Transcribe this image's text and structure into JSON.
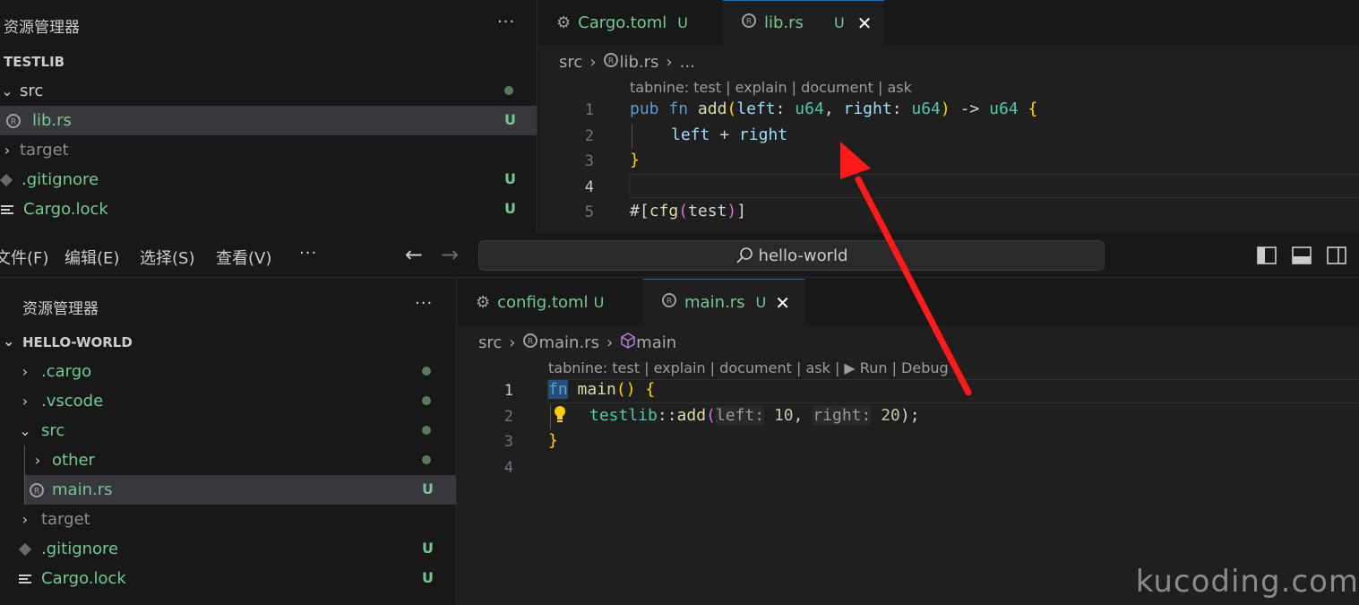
{
  "top_window": {
    "sidebar": {
      "title": "资源管理器",
      "more": "···",
      "project": "TESTLIB",
      "items": [
        {
          "label": "src",
          "badge": ""
        },
        {
          "label": "lib.rs",
          "badge": "U"
        },
        {
          "label": "target",
          "badge": ""
        },
        {
          "label": ".gitignore",
          "badge": "U"
        },
        {
          "label": "Cargo.lock",
          "badge": "U"
        }
      ]
    },
    "tabs": [
      {
        "label": "Cargo.toml",
        "badge": "U"
      },
      {
        "label": "lib.rs",
        "badge": "U",
        "close": "✕"
      }
    ],
    "breadcrumb": {
      "folder": "src",
      "file": "lib.rs",
      "tail": "..."
    },
    "codelens": "tabnine: test | explain | document | ask",
    "line_numbers": [
      "1",
      "2",
      "3",
      "4",
      "5"
    ],
    "code": {
      "l1": {
        "pub": "pub",
        "fn": "fn",
        "name": "add",
        "p1": "left",
        "t1": "u64",
        "p2": "right",
        "t2": "u64",
        "arrow": "->",
        "ret": "u64"
      },
      "l2": {
        "a": "left",
        "op": "+",
        "b": "right"
      },
      "l3": "}",
      "l5": {
        "hash": "#[",
        "attr": "cfg",
        "arg": "test",
        "close": "]"
      }
    }
  },
  "bottom_window": {
    "menu": [
      "文件(F)",
      "编辑(E)",
      "选择(S)",
      "查看(V)"
    ],
    "more": "···",
    "search": "hello-world",
    "sidebar": {
      "title": "资源管理器",
      "more": "···",
      "project": "HELLO-WORLD",
      "items": [
        {
          "label": ".cargo",
          "badge": ""
        },
        {
          "label": ".vscode",
          "badge": ""
        },
        {
          "label": "src",
          "badge": ""
        },
        {
          "label": "other",
          "badge": ""
        },
        {
          "label": "main.rs",
          "badge": "U"
        },
        {
          "label": "target",
          "badge": ""
        },
        {
          "label": ".gitignore",
          "badge": "U"
        },
        {
          "label": "Cargo.lock",
          "badge": "U"
        }
      ]
    },
    "tabs": [
      {
        "label": "config.toml",
        "badge": "U"
      },
      {
        "label": "main.rs",
        "badge": "U",
        "close": "✕"
      }
    ],
    "breadcrumb": {
      "folder": "src",
      "file": "main.rs",
      "symbol": "main"
    },
    "codelens": "tabnine: test | explain | document | ask | ▶ Run | Debug",
    "line_numbers": [
      "1",
      "2",
      "3",
      "4"
    ],
    "code": {
      "l1": {
        "fn": "fn",
        "name": "main",
        "parens": "()",
        "brace": "{"
      },
      "l2": {
        "mod": "testlib",
        "sep": "::",
        "fn": "add",
        "h1": "left:",
        "v1": "10",
        "h2": "right:",
        "v2": "20",
        "end": ");"
      },
      "l3": "}"
    }
  },
  "watermark": "kucoding.com",
  "colors": {
    "accent": "#0078d4",
    "untracked": "#73c991",
    "arrow": "#ff1a1a"
  }
}
